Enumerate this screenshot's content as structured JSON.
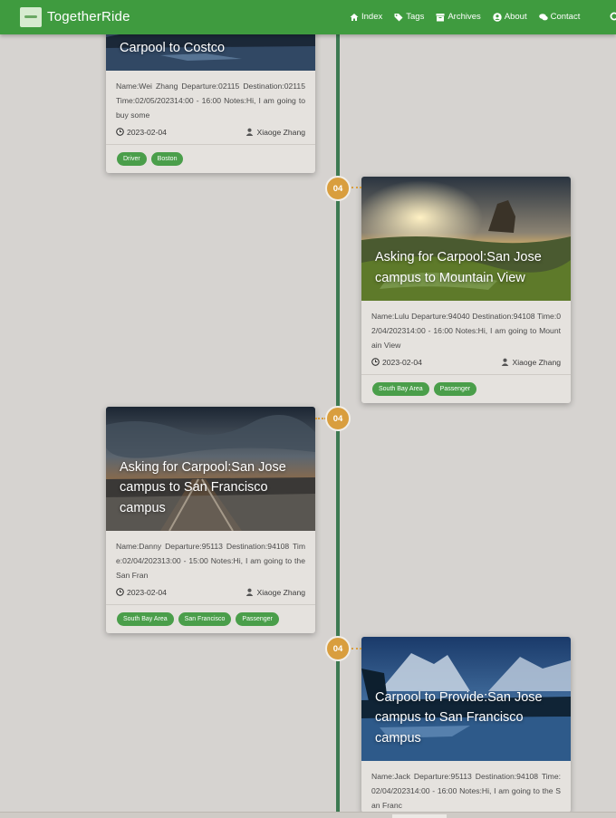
{
  "navbar": {
    "brand": "TogetherRide",
    "items": [
      {
        "label": "Index",
        "icon": "home-icon"
      },
      {
        "label": "Tags",
        "icon": "tags-icon"
      },
      {
        "label": "Archives",
        "icon": "archive-icon"
      },
      {
        "label": "About",
        "icon": "user-circle-icon"
      },
      {
        "label": "Contact",
        "icon": "comments-icon"
      }
    ]
  },
  "timeline": {
    "node_label": "04",
    "accent_color": "#d99e3e",
    "line_color": "#3d7a52"
  },
  "cards": [
    {
      "title": "Carpool to Costco",
      "description": "Name:Wei Zhang Departure:02115 Destination:02115 Time:02/05/202314:00 - 16:00 Notes:Hi, I am going to buy some",
      "date": "2023-02-04",
      "author": "Xiaoge Zhang",
      "tags": [
        "Driver",
        "Boston"
      ]
    },
    {
      "title": "Asking for Carpool:San Jose campus to Mountain View",
      "description": "Name:Lulu Departure:94040 Destination:94108 Time:02/04/202314:00 - 16:00 Notes:Hi, I am going to Mountain View",
      "date": "2023-02-04",
      "author": "Xiaoge Zhang",
      "tags": [
        "South Bay Area",
        "Passenger"
      ]
    },
    {
      "title": "Asking for Carpool:San Jose campus to San Francisco campus",
      "description": "Name:Danny Departure:95113 Destination:94108 Time:02/04/202313:00 - 15:00 Notes:Hi, I am going to the San Fran",
      "date": "2023-02-04",
      "author": "Xiaoge Zhang",
      "tags": [
        "South Bay Area",
        "San Francisco",
        "Passenger"
      ]
    },
    {
      "title": "Carpool to Provide:San Jose campus to San Francisco campus",
      "description": "Name:Jack Departure:95113 Destination:94108 Time:02/04/202314:00 - 16:00 Notes:Hi, I am going to the San Franc",
      "date": "",
      "author": "",
      "tags": []
    }
  ]
}
